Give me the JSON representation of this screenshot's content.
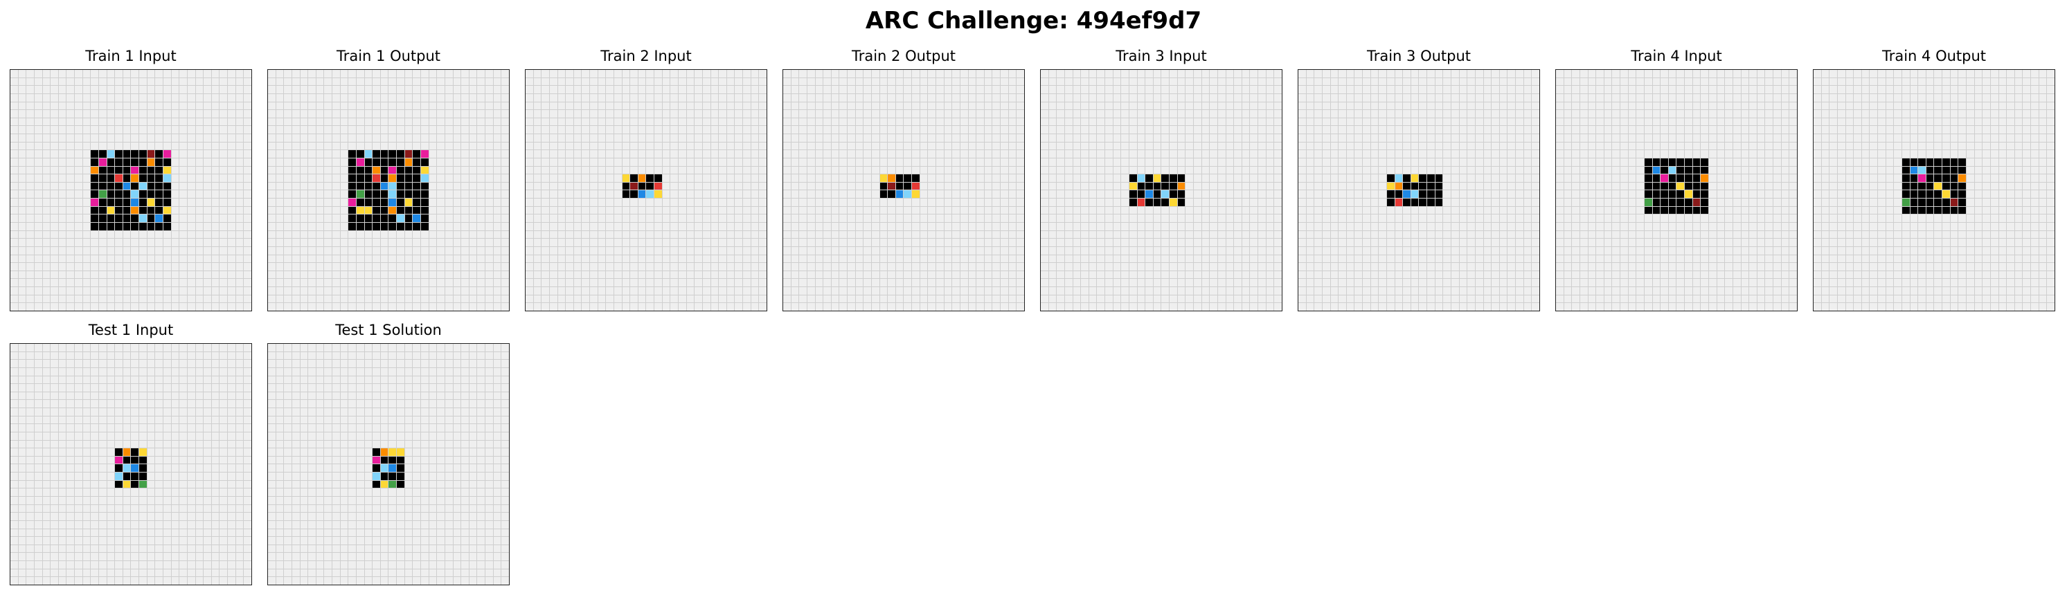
{
  "title": "ARC Challenge: 494ef9d7",
  "palette": {
    "0": "#000000",
    "1": "#1e88e5",
    "2": "#e53935",
    "3": "#43a047",
    "4": "#fdd835",
    "5": "#9e9e9e",
    "6": "#e91e9c",
    "7": "#fb8c00",
    "8": "#81d4fa",
    "9": "#8b1a1a",
    "bg": "#efefef"
  },
  "panels": [
    {
      "label": "Train 1 Input",
      "size": 30,
      "blocks": [
        {
          "row": 10,
          "col": 10,
          "cells": [
            [
              0,
              0,
              8,
              0,
              0,
              0,
              0,
              9,
              0,
              6
            ],
            [
              0,
              6,
              0,
              0,
              0,
              0,
              0,
              7,
              0,
              0
            ],
            [
              7,
              0,
              0,
              0,
              0,
              6,
              0,
              0,
              0,
              4
            ],
            [
              0,
              0,
              0,
              2,
              0,
              7,
              0,
              0,
              0,
              8
            ],
            [
              0,
              0,
              0,
              0,
              1,
              0,
              8,
              0,
              0,
              0
            ],
            [
              0,
              3,
              0,
              0,
              0,
              8,
              0,
              0,
              0,
              0
            ],
            [
              6,
              0,
              0,
              0,
              0,
              1,
              0,
              4,
              0,
              0
            ],
            [
              0,
              0,
              4,
              0,
              0,
              7,
              0,
              0,
              0,
              4
            ],
            [
              0,
              0,
              0,
              0,
              0,
              0,
              8,
              0,
              1,
              0
            ],
            [
              0,
              0,
              0,
              0,
              0,
              0,
              0,
              0,
              0,
              0
            ]
          ]
        }
      ]
    },
    {
      "label": "Train 1 Output",
      "size": 30,
      "blocks": [
        {
          "row": 10,
          "col": 10,
          "cells": [
            [
              0,
              0,
              8,
              0,
              0,
              0,
              0,
              9,
              0,
              6
            ],
            [
              0,
              6,
              0,
              0,
              0,
              0,
              0,
              7,
              0,
              0
            ],
            [
              0,
              0,
              0,
              7,
              0,
              6,
              0,
              0,
              0,
              4
            ],
            [
              0,
              0,
              0,
              2,
              0,
              7,
              0,
              0,
              0,
              8
            ],
            [
              0,
              0,
              0,
              0,
              1,
              8,
              0,
              0,
              0,
              0
            ],
            [
              0,
              3,
              0,
              0,
              0,
              8,
              0,
              0,
              0,
              0
            ],
            [
              6,
              0,
              0,
              0,
              0,
              1,
              0,
              4,
              0,
              0
            ],
            [
              0,
              4,
              4,
              0,
              0,
              7,
              0,
              0,
              0,
              0
            ],
            [
              0,
              0,
              0,
              0,
              0,
              0,
              8,
              0,
              1,
              0
            ],
            [
              0,
              0,
              0,
              0,
              0,
              0,
              0,
              0,
              0,
              0
            ]
          ]
        }
      ]
    },
    {
      "label": "Train 2 Input",
      "size": 30,
      "blocks": [
        {
          "row": 13,
          "col": 12,
          "cells": [
            [
              4,
              0,
              7,
              0,
              0
            ],
            [
              0,
              9,
              0,
              0,
              2
            ],
            [
              0,
              0,
              1,
              8,
              4
            ]
          ]
        }
      ]
    },
    {
      "label": "Train 2 Output",
      "size": 30,
      "blocks": [
        {
          "row": 13,
          "col": 12,
          "cells": [
            [
              4,
              7,
              0,
              0,
              0
            ],
            [
              0,
              9,
              0,
              0,
              2
            ],
            [
              0,
              0,
              1,
              8,
              4
            ]
          ]
        }
      ]
    },
    {
      "label": "Train 3 Input",
      "size": 30,
      "blocks": [
        {
          "row": 13,
          "col": 11,
          "cells": [
            [
              0,
              8,
              0,
              4,
              0,
              0,
              0
            ],
            [
              4,
              0,
              0,
              0,
              0,
              0,
              7
            ],
            [
              0,
              0,
              1,
              0,
              8,
              0,
              0
            ],
            [
              0,
              2,
              0,
              0,
              0,
              4,
              0
            ]
          ]
        }
      ]
    },
    {
      "label": "Train 3 Output",
      "size": 30,
      "blocks": [
        {
          "row": 13,
          "col": 11,
          "cells": [
            [
              0,
              8,
              0,
              4,
              0,
              0,
              0
            ],
            [
              4,
              7,
              0,
              0,
              0,
              0,
              0
            ],
            [
              0,
              0,
              1,
              8,
              0,
              0,
              0
            ],
            [
              0,
              2,
              0,
              0,
              0,
              0,
              0
            ]
          ]
        }
      ]
    },
    {
      "label": "Train 4 Input",
      "size": 30,
      "blocks": [
        {
          "row": 11,
          "col": 11,
          "cells": [
            [
              0,
              0,
              0,
              0,
              0,
              0,
              0,
              0
            ],
            [
              0,
              1,
              0,
              8,
              0,
              0,
              0,
              0
            ],
            [
              0,
              0,
              6,
              0,
              0,
              0,
              0,
              7
            ],
            [
              0,
              0,
              0,
              0,
              4,
              0,
              0,
              0
            ],
            [
              0,
              0,
              0,
              0,
              0,
              4,
              0,
              0
            ],
            [
              3,
              0,
              0,
              0,
              0,
              0,
              9,
              0
            ],
            [
              0,
              0,
              0,
              0,
              0,
              0,
              0,
              0
            ]
          ]
        }
      ]
    },
    {
      "label": "Train 4 Output",
      "size": 30,
      "blocks": [
        {
          "row": 11,
          "col": 11,
          "cells": [
            [
              0,
              0,
              0,
              0,
              0,
              0,
              0,
              0
            ],
            [
              0,
              1,
              8,
              0,
              0,
              0,
              0,
              0
            ],
            [
              0,
              0,
              6,
              0,
              0,
              0,
              0,
              7
            ],
            [
              0,
              0,
              0,
              0,
              4,
              0,
              0,
              0
            ],
            [
              0,
              0,
              0,
              0,
              0,
              4,
              0,
              0
            ],
            [
              3,
              0,
              0,
              0,
              0,
              0,
              9,
              0
            ],
            [
              0,
              0,
              0,
              0,
              0,
              0,
              0,
              0
            ]
          ]
        }
      ]
    },
    {
      "label": "Test 1 Input",
      "size": 30,
      "blocks": [
        {
          "row": 13,
          "col": 13,
          "cells": [
            [
              0,
              7,
              0,
              4
            ],
            [
              6,
              0,
              0,
              0
            ],
            [
              0,
              8,
              1,
              0
            ],
            [
              8,
              0,
              0,
              0
            ],
            [
              0,
              4,
              0,
              3
            ]
          ]
        }
      ]
    },
    {
      "label": "Test 1 Solution",
      "size": 30,
      "blocks": [
        {
          "row": 13,
          "col": 13,
          "cells": [
            [
              0,
              7,
              4,
              4
            ],
            [
              6,
              0,
              0,
              0
            ],
            [
              0,
              8,
              1,
              0
            ],
            [
              8,
              0,
              0,
              0
            ],
            [
              0,
              4,
              3,
              0
            ]
          ]
        }
      ]
    }
  ]
}
